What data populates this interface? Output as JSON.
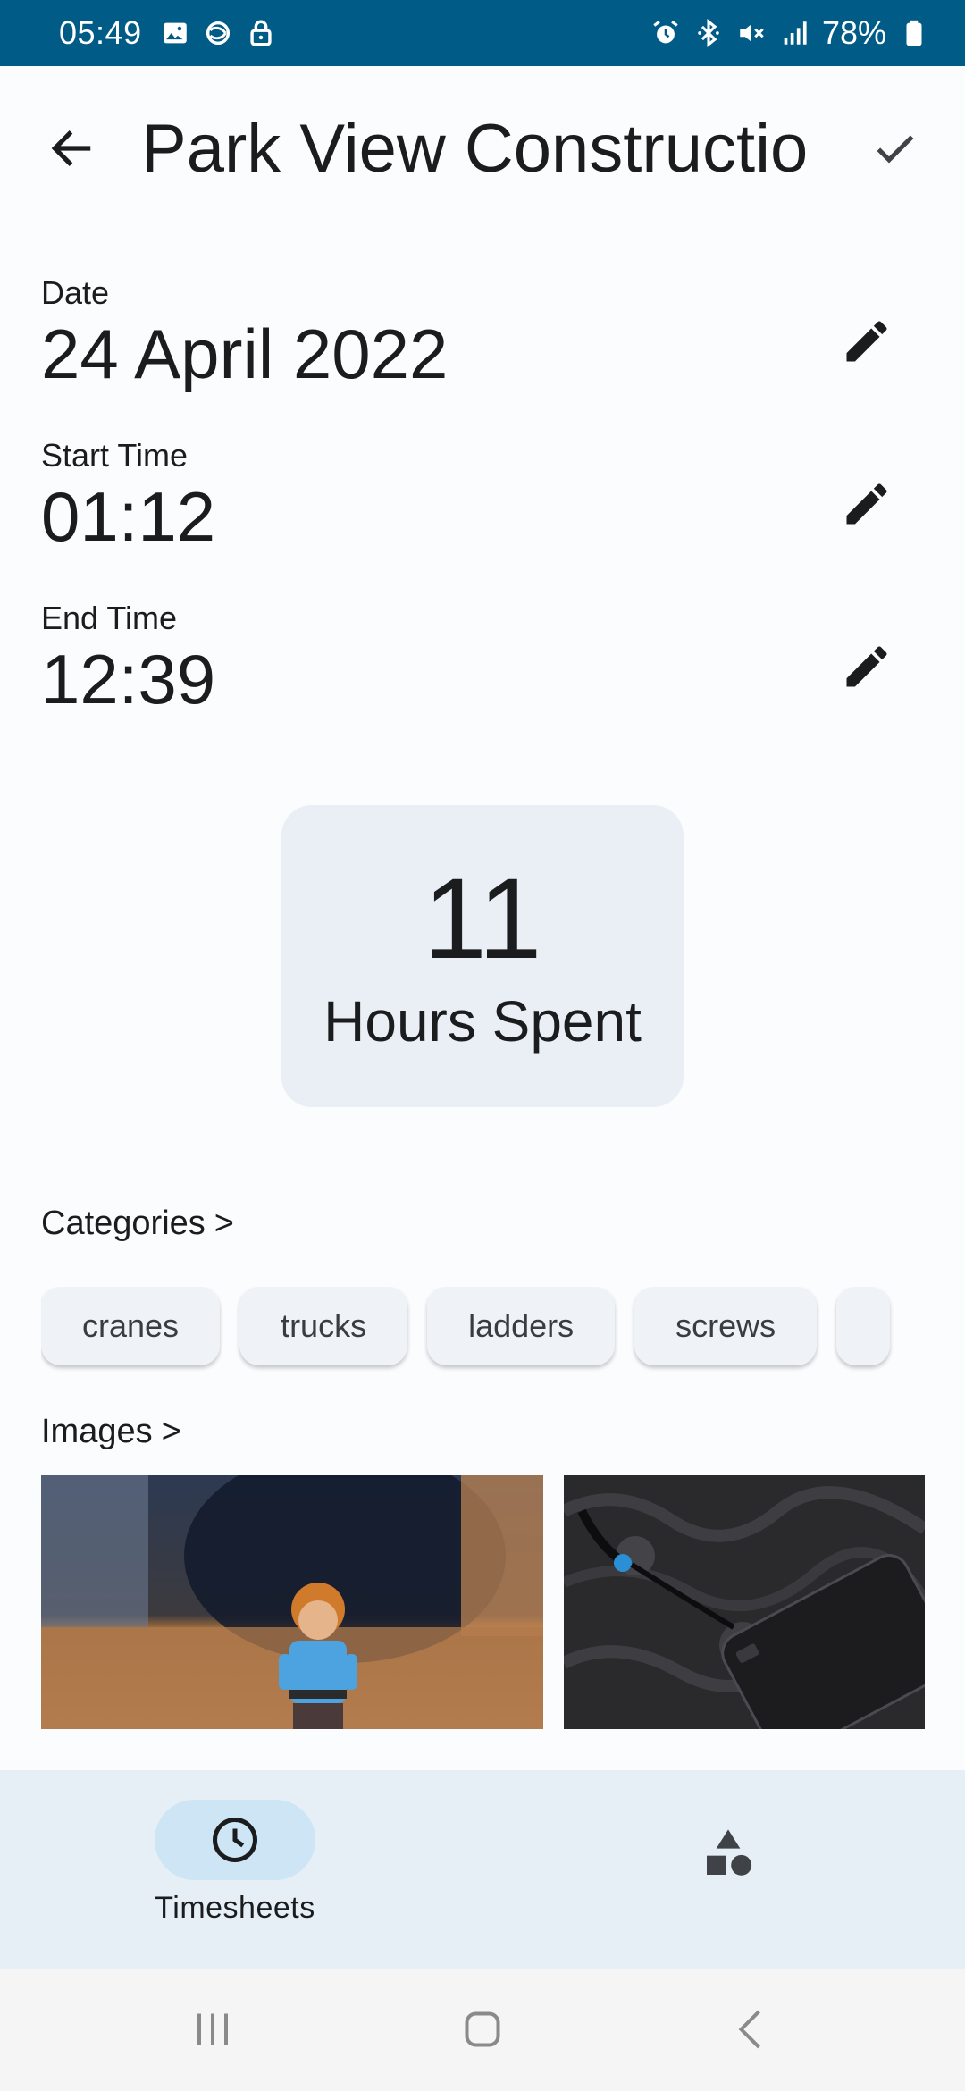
{
  "status_bar": {
    "time": "05:49",
    "battery": "78%",
    "left_icons": [
      "image-icon",
      "sync-icon",
      "lock-icon"
    ],
    "right_icons": [
      "alarm-icon",
      "bluetooth-icon",
      "mute-icon",
      "signal-icon",
      "battery-icon"
    ]
  },
  "app_bar": {
    "title": "Park View Constructio"
  },
  "fields": {
    "date": {
      "label": "Date",
      "value": "24 April 2022"
    },
    "start_time": {
      "label": "Start Time",
      "value": "01:12"
    },
    "end_time": {
      "label": "End Time",
      "value": "12:39"
    }
  },
  "hours": {
    "value": "11",
    "label": "Hours Spent"
  },
  "categories": {
    "label": "Categories",
    "chevron": ">",
    "items": [
      "cranes",
      "trucks",
      "ladders",
      "screws"
    ]
  },
  "images": {
    "label": "Images",
    "chevron": ">"
  },
  "bottom_nav": {
    "items": [
      {
        "label": "Timesheets",
        "icon": "clock-icon",
        "selected": true
      },
      {
        "label": "",
        "icon": "shapes-icon",
        "selected": false
      }
    ]
  },
  "colors": {
    "status_bar": "#005b87",
    "background": "#fbfcfe",
    "card": "#e9eff5",
    "nav_background": "#e6eef6",
    "nav_selected_pill": "#cde5f4"
  }
}
